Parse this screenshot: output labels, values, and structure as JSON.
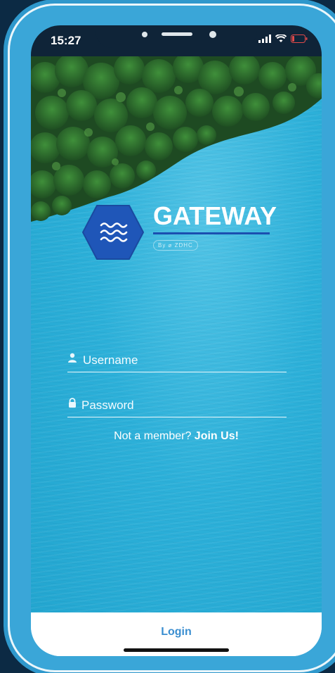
{
  "status": {
    "time": "15:27"
  },
  "brand": {
    "name": "GATEWAY",
    "tagline": "By ⌀ ZDHC"
  },
  "login_form": {
    "username_placeholder": "Username",
    "password_placeholder": "Password",
    "join_prompt": "Not a member? ",
    "join_link": "Join Us!",
    "login_label": "Login"
  },
  "colors": {
    "frame": "#3aa6d8",
    "water": "#2fb1da",
    "logo_blue": "#1f56b8",
    "login_text": "#3a8ed0",
    "background": "#0c2a44"
  },
  "icons": {
    "status": [
      "signal-icon",
      "wifi-icon",
      "battery-icon"
    ],
    "form": [
      "user-icon",
      "lock-icon"
    ],
    "logo": "waves-icon"
  }
}
